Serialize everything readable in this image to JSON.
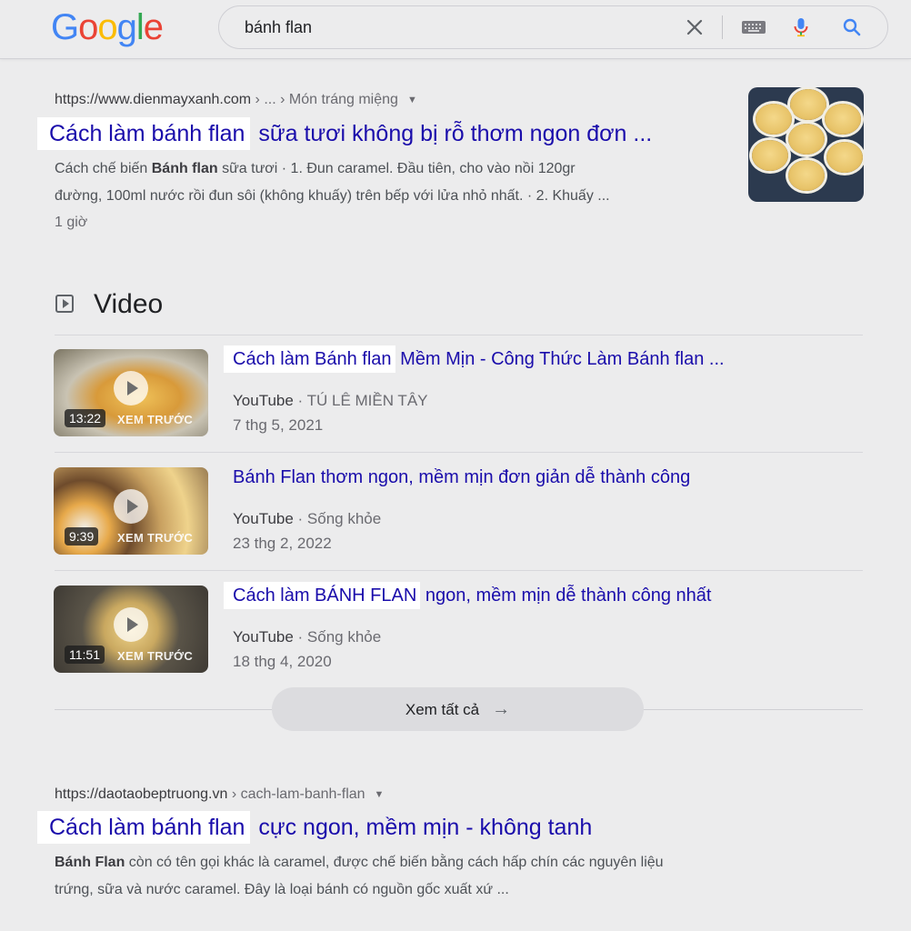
{
  "header": {
    "logo_letters": [
      "G",
      "o",
      "o",
      "g",
      "l",
      "e"
    ],
    "logo_colors": [
      "#4285f4",
      "#ea4335",
      "#fbbc05",
      "#4285f4",
      "#34a853",
      "#ea4335"
    ],
    "search_query": "bánh flan",
    "icons": [
      "close-icon",
      "keyboard-icon",
      "microphone-icon",
      "search-icon"
    ]
  },
  "result1": {
    "site": "https://www.dienmayxanh.com",
    "path": " › ... › Món tráng miệng",
    "title_highlight": "Cách làm bánh flan",
    "title_rest": " sữa tươi không bị rỗ thơm ngon đơn ...",
    "snippet_line1_pre": "Cách chế biến ",
    "snippet_line1_bold": "Bánh flan",
    "snippet_line1_post": " sữa tươi · 1. Đun caramel. Đầu tiên, cho vào nồi 120gr",
    "snippet_line2": "đường, 100ml nước rồi đun sôi (không khuấy) trên bếp với lửa nhỏ nhất. · 2. Khuấy ...",
    "age": "1 giờ"
  },
  "video_section": {
    "heading": "Video",
    "items": [
      {
        "duration": "13:22",
        "overlay": "XEM TRƯỚC",
        "title_highlight": "Cách làm Bánh flan",
        "title_rest": " Mềm Mịn - Công Thức Làm Bánh flan ...",
        "source": "YouTube",
        "channel": " · TÚ LÊ MIỀN TÂY",
        "date": "7 thg 5, 2021"
      },
      {
        "duration": "9:39",
        "overlay": "XEM TRƯỚC",
        "title_highlight": "",
        "title_rest": "Bánh Flan thơm ngon, mềm mịn đơn giản dễ thành công",
        "source": "YouTube",
        "channel": " · Sống khỏe",
        "date": "23 thg 2, 2022"
      },
      {
        "duration": "11:51",
        "overlay": "XEM TRƯỚC",
        "title_highlight": "Cách làm BÁNH FLAN",
        "title_rest": " ngon, mềm mịn dễ thành công nhất",
        "source": "YouTube",
        "channel": " · Sống khỏe",
        "date": "18 thg 4, 2020"
      }
    ],
    "see_all": "Xem tất cả"
  },
  "result2": {
    "site": "https://daotaobeptruong.vn",
    "path": " › cach-lam-banh-flan",
    "title_highlight": "Cách làm bánh flan",
    "title_rest": " cực ngon, mềm mịn - không tanh",
    "snippet_line1_bold": "Bánh Flan",
    "snippet_line1_post": " còn có tên gọi khác là caramel, được chế biến bằng cách hấp chín các nguyên liệu",
    "snippet_line2": "trứng, sữa và nước caramel. Đây là loại bánh có nguồn gốc xuất xứ ..."
  }
}
